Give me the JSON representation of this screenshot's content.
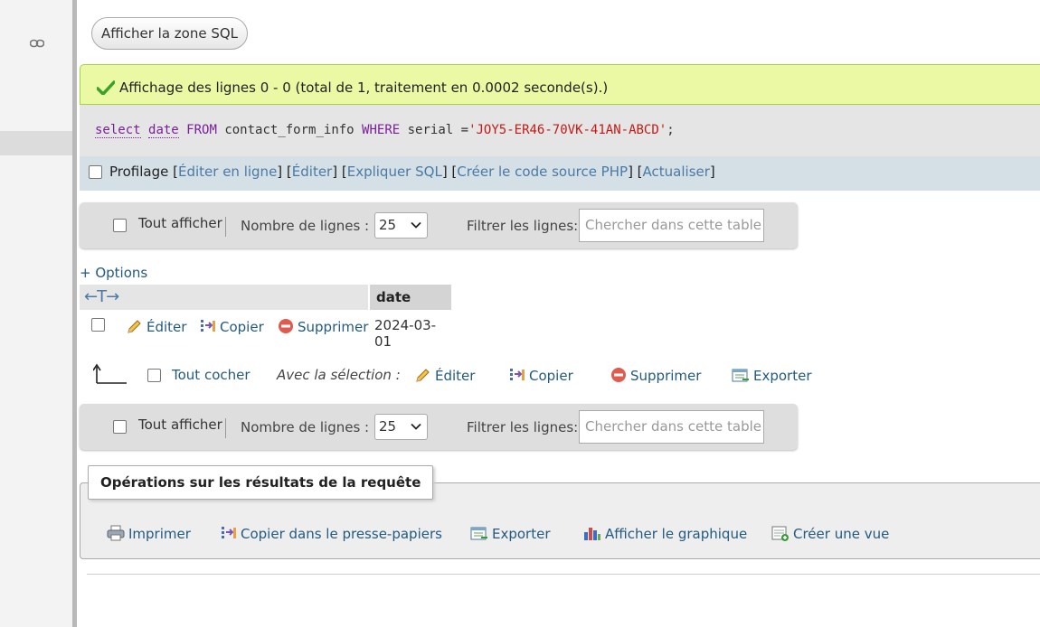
{
  "sql_button": "Afficher la zone SQL",
  "success_message": "Affichage des lignes 0 - 0 (total de 1, traitement en 0.0002 seconde(s).)",
  "sql": {
    "select": "select",
    "col": "date",
    "from": "FROM",
    "table": " contact_form_info ",
    "where": "WHERE",
    "cond": " serial =",
    "value": "'JOY5-ER46-70VK-41AN-ABCD'",
    "end": ";"
  },
  "tools": {
    "profiling": "Profilage",
    "open": " [",
    "edit_inline": "Éditer en ligne",
    "edit": "Éditer",
    "explain": "Expliquer SQL",
    "php": "Créer le code source PHP",
    "refresh": "Actualiser",
    "sep": "] [",
    "close": "]"
  },
  "navbar": {
    "show_all": "Tout afficher",
    "rows_label": "Nombre de lignes :",
    "rows_value": "25",
    "filter_label": "Filtrer les lignes:",
    "filter_placeholder": "Chercher dans cette table"
  },
  "options_link": "+ Options",
  "table": {
    "arrows": "←T→",
    "column": "date",
    "row": {
      "edit": "Éditer",
      "copy": "Copier",
      "delete": "Supprimer",
      "value": "2024-03-01"
    }
  },
  "multi": {
    "check_all": "Tout cocher",
    "with_selection": "Avec la sélection :",
    "edit": "Éditer",
    "copy": "Copier",
    "delete": "Supprimer",
    "export": "Exporter"
  },
  "operations": {
    "legend": "Opérations sur les résultats de la requête",
    "print": "Imprimer",
    "copy_clipboard": "Copier dans le presse-papiers",
    "export": "Exporter",
    "chart": "Afficher le graphique",
    "create_view": "Créer une vue"
  },
  "colors": {
    "link": "#235a81",
    "success_bg": "#ebf8a4",
    "tools_bg": "#d5dfe6"
  }
}
